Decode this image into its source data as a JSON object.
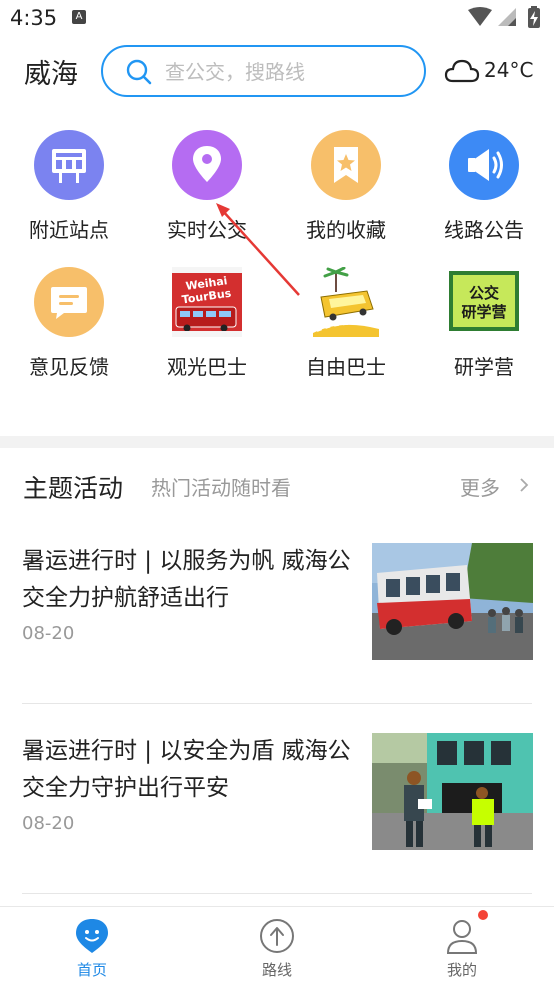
{
  "status_bar": {
    "time": "4:35",
    "notification_badge": "A"
  },
  "header": {
    "city": "威海",
    "search_placeholder": "查公交，搜路线",
    "temperature": "24°C"
  },
  "grid": [
    {
      "label": "附近站点",
      "icon": "bus-stop-sign-icon",
      "color": "#7b83f0"
    },
    {
      "label": "实时公交",
      "icon": "location-pin-icon",
      "color": "#b56cf2"
    },
    {
      "label": "我的收藏",
      "icon": "bookmark-star-icon",
      "color": "#f7bf6a"
    },
    {
      "label": "线路公告",
      "icon": "speaker-icon",
      "color": "#3d8af5"
    },
    {
      "label": "意见反馈",
      "icon": "feedback-chat-icon",
      "color": "#f7bf6a"
    },
    {
      "label": "观光巴士",
      "icon": "tour-bus-image",
      "color": "#d32f2f"
    },
    {
      "label": "自由巴士",
      "icon": "free-bus-image",
      "color": "#f4c430"
    },
    {
      "label": "研学营",
      "icon": "study-camp-image",
      "color": "#2e7d32"
    }
  ],
  "tour_bus_text": {
    "line1": "Weihai",
    "line2": "TourBus"
  },
  "study_camp_text": {
    "line1": "公交",
    "line2": "研学营"
  },
  "section": {
    "title": "主题活动",
    "subtitle": "热门活动随时看",
    "more": "更多"
  },
  "news": [
    {
      "title": "暑运进行时 | 以服务为帆 威海公交全力护航舒适出行",
      "date": "08-20"
    },
    {
      "title": "暑运进行时 | 以安全为盾 威海公交全力守护出行平安",
      "date": "08-20"
    }
  ],
  "bottom_nav": [
    {
      "label": "首页",
      "active": true
    },
    {
      "label": "路线",
      "active": false
    },
    {
      "label": "我的",
      "active": false
    }
  ],
  "colors": {
    "accent": "#2196f3",
    "active_nav": "#1e88e5",
    "inactive_nav": "#666666",
    "badge": "#f44336"
  }
}
